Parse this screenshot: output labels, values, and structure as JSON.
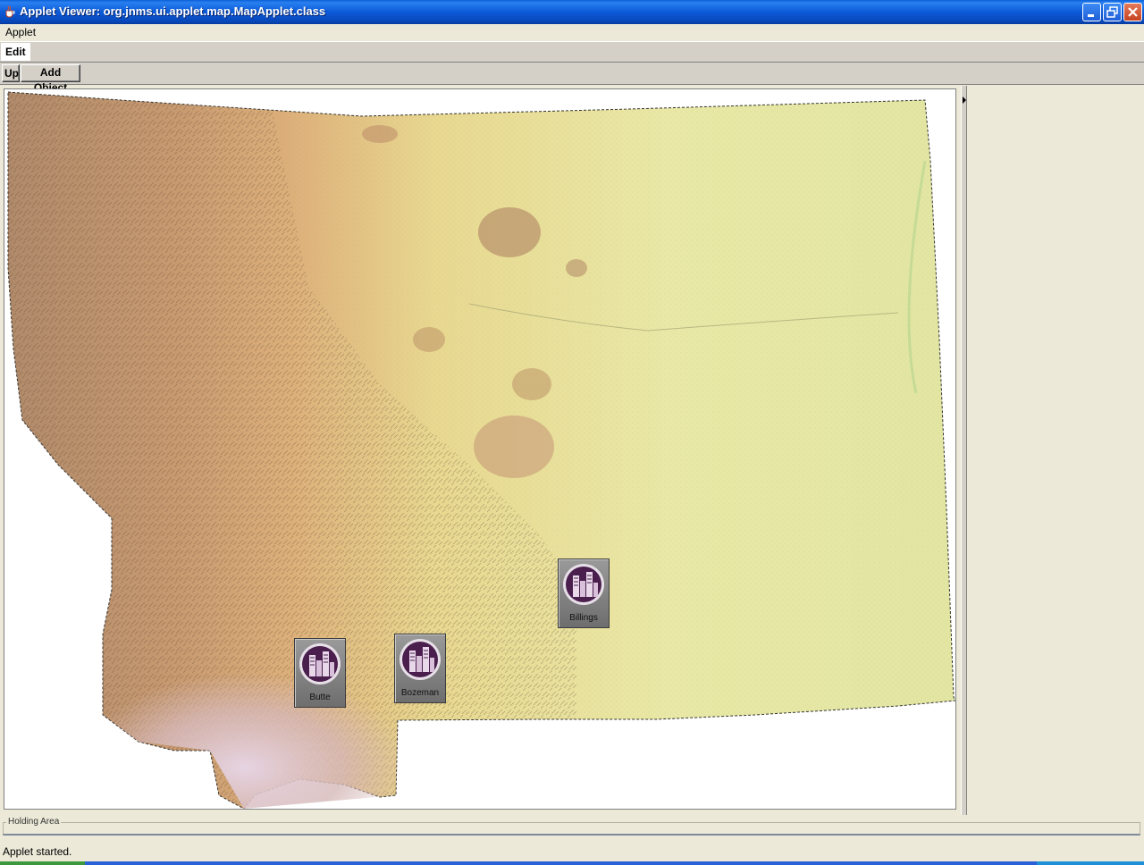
{
  "window": {
    "title": "Applet Viewer: org.jnms.ui.applet.map.MapApplet.class",
    "controls": {
      "minimize": "minimize-icon",
      "restore": "restore-icon",
      "close": "close-icon"
    }
  },
  "menubar": {
    "items": [
      "Applet"
    ]
  },
  "tabs": [
    {
      "label": "Edit",
      "selected": true
    }
  ],
  "toolbar": {
    "up_label": "Up",
    "add_object_label": "Add Object"
  },
  "map": {
    "region": "Montana terrain map",
    "markers": [
      {
        "label": "Billings",
        "icon": "city-buildings-icon"
      },
      {
        "label": "Butte",
        "icon": "city-buildings-icon"
      },
      {
        "label": "Bozeman",
        "icon": "city-buildings-icon"
      }
    ],
    "colors": {
      "marker_circle": "#4a1f4e",
      "marker_bg": "#8a8a8a",
      "terrain_low": "#e8e9a8",
      "terrain_high": "#c89a6a",
      "terrain_peak": "#e6d6e6"
    }
  },
  "holding_area": {
    "label": "Holding Area"
  },
  "status": {
    "text": "Applet started."
  }
}
